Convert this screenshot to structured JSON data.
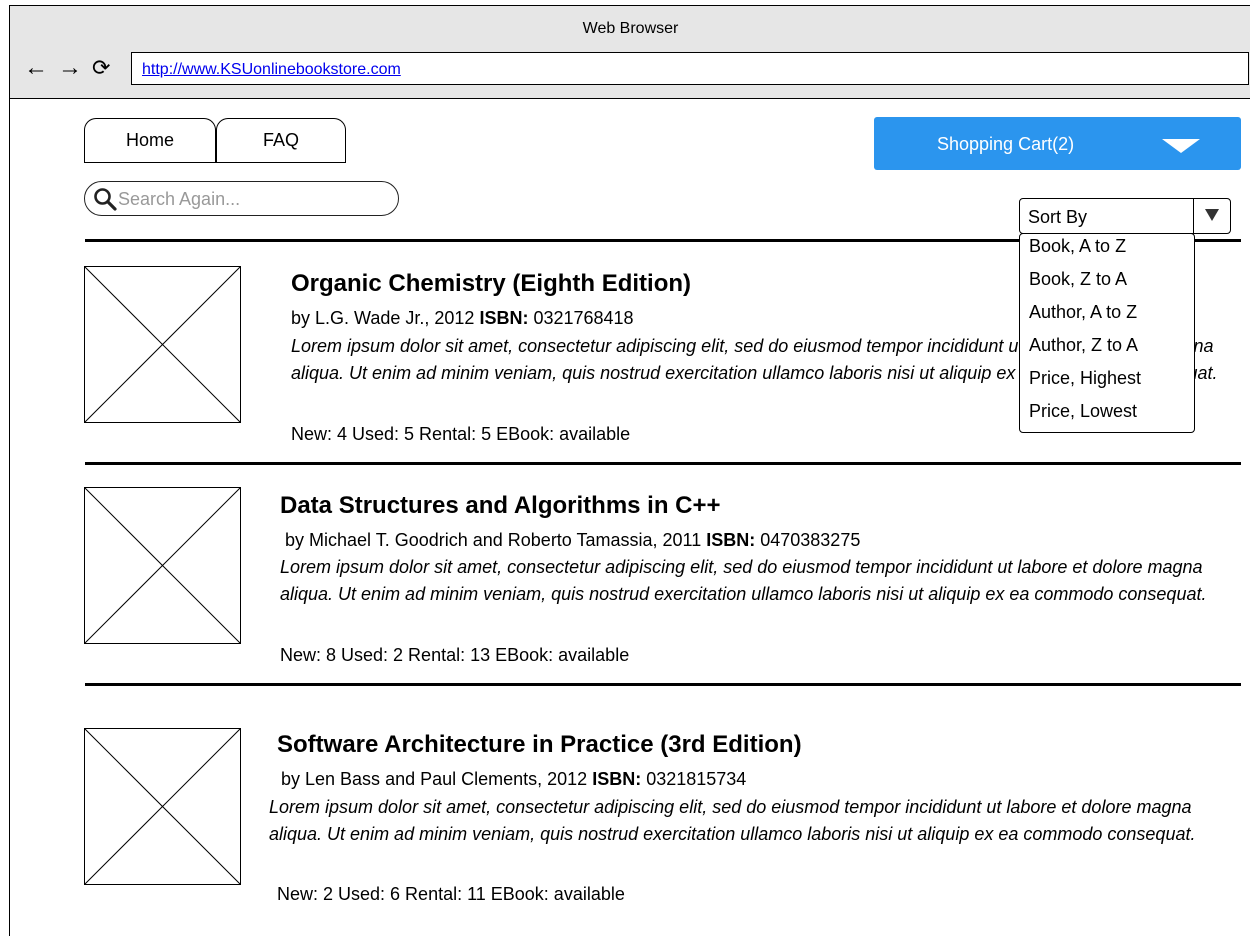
{
  "window": {
    "title": "Web Browser"
  },
  "browser": {
    "back_glyph": "←",
    "forward_glyph": "→",
    "reload_glyph": "⟳",
    "url": "http://www.KSUonlinebookstore.com"
  },
  "nav_tabs": [
    {
      "label": "Home"
    },
    {
      "label": "FAQ"
    }
  ],
  "cart": {
    "label": "Shopping Cart(2)",
    "color": "#2b95ee"
  },
  "search": {
    "placeholder": "Search Again..."
  },
  "sort": {
    "label": "Sort By",
    "options": [
      "Book, A to Z",
      "Book, Z to A",
      "Author, A to Z",
      "Author, Z to A",
      "Price, Highest",
      "Price, Lowest"
    ]
  },
  "books": [
    {
      "title": "Organic Chemistry (Eighth Edition)",
      "byline": "by L.G. Wade Jr., 2012 ",
      "isbn_label": "ISBN:",
      "isbn": " 0321768418",
      "description": "Lorem ipsum dolor sit amet, consectetur adipiscing elit, sed do eiusmod tempor incididunt ut labore et dolore magna aliqua. Ut enim ad minim veniam, quis nostrud exercitation ullamco laboris nisi ut aliquip ex ea commodo consequat.",
      "stock": "New: 4 Used: 5 Rental: 5  EBook: available"
    },
    {
      "title": "Data Structures and Algorithms in C++",
      "byline": "by Michael T. Goodrich and Roberto Tamassia, 2011 ",
      "isbn_label": "ISBN:",
      "isbn": " 0470383275",
      "description": "Lorem ipsum dolor sit amet, consectetur adipiscing elit, sed do eiusmod tempor incididunt ut labore et dolore magna aliqua. Ut enim ad minim veniam, quis nostrud exercitation ullamco laboris nisi ut aliquip ex ea commodo consequat.",
      "stock": "New: 8 Used: 2 Rental: 13  EBook: available"
    },
    {
      "title": "Software Architecture in Practice (3rd Edition)",
      "byline": "by Len Bass and Paul Clements, 2012 ",
      "isbn_label": "ISBN:",
      "isbn": " 0321815734",
      "description": "Lorem ipsum dolor sit amet, consectetur adipiscing elit, sed do eiusmod tempor incididunt ut labore et dolore magna aliqua. Ut enim ad minim veniam, quis nostrud exercitation ullamco laboris nisi ut aliquip ex ea commodo consequat.",
      "stock": "New: 2 Used: 6 Rental: 11  EBook: available"
    }
  ]
}
